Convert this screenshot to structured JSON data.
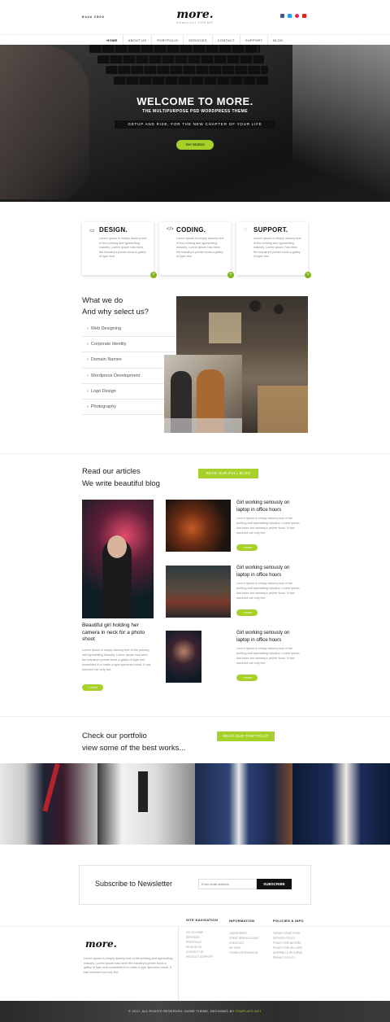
{
  "header": {
    "est": "Estd 1900",
    "logo": "more.",
    "tagline": "Beautiful THEME",
    "social": [
      {
        "icon": "facebook-icon",
        "color": "#3b5998"
      },
      {
        "icon": "twitter-icon",
        "color": "#1da1f2"
      },
      {
        "icon": "pinterest-icon",
        "color": "#e0245e"
      },
      {
        "icon": "youtube-icon",
        "color": "#e62117"
      }
    ]
  },
  "nav": [
    "HOME",
    "ABOUT US",
    "PORTFOLIO",
    "SERVICES",
    "CONTACT",
    "SUPPORT",
    "BLOG"
  ],
  "hero": {
    "title": "WELCOME TO MORE.",
    "subtitle": "THE MULTIPURPOSE PSD WORDPRESS THEME",
    "bar": "GETUP AND RISE, FOR THE NEW CHAPTER OF YOUR LIFE",
    "button": "Get Started"
  },
  "services": [
    {
      "icon": "monitor-icon",
      "glyph": "▭",
      "title": "DESIGN.",
      "text": "Lorem Ipsum is simply dummy text of the printing and typesetting industry. Lorem Ipsum has been the industry's printer book a galley of type and"
    },
    {
      "icon": "code-icon",
      "glyph": "</>",
      "title": "CODING.",
      "text": "Lorem Ipsum is simply dummy text of the printing and typesetting industry. Lorem Ipsum has been the industry's printer book a galley of type and"
    },
    {
      "icon": "chat-icon",
      "glyph": "◌",
      "title": "SUPPORT.",
      "text": "Lorem Ipsum is simply dummy text of the printing and typesetting industry. Lorem Ipsum has been the industry's printer book a galley of type and"
    }
  ],
  "what": {
    "title_line1": "What we do",
    "title_line2": "And why select us?",
    "items": [
      "Web Designing",
      "Corporate Identity",
      "Domain Names",
      "Wordpress Development",
      "Logo Design",
      "Photography"
    ]
  },
  "blog": {
    "title_line1": "Read our articles",
    "title_line2": "We write beautiful blog",
    "button": "READ OUR FULL BLOG",
    "featured": {
      "title": "Beautiful girl holding her camera in neck for a photo shoot",
      "text": "Lorem Ipsum is simply dummy text of the printing and typesetting industry. Lorem Ipsum has been the industry's printer book a galley of type and scrambled it to make a type specimen book. It has survived not only five",
      "more": "+ more"
    },
    "posts": [
      {
        "title": "Girl working seriously on laptop in office hours",
        "text": "Lorem Ipsum is simply dummy text of the printing and typesetting industry. Lorem Ipsum has been the industry's printer book. It has survived not only five",
        "more": "+ more"
      },
      {
        "title": "Girl working seriously on laptop in office hours",
        "text": "Lorem Ipsum is simply dummy text of the printing and typesetting industry. Lorem Ipsum has been the industry's printer book. It has survived not only five",
        "more": "+ more"
      },
      {
        "title": "Girl working seriously on laptop in office hours",
        "text": "Lorem Ipsum is simply dummy text of the printing and typesetting industry. Lorem Ipsum has been the industry's printer book. It has survived not only five",
        "more": "+ more"
      }
    ]
  },
  "portfolio": {
    "title_line1": "Check our portfolio",
    "title_line2": "view some of the best works...",
    "button": "READ OUR PORTFOLIO"
  },
  "newsletter": {
    "title": "Subscribe to Newsletter",
    "placeholder": "Enter email address",
    "button": "SUBSCRIBE"
  },
  "footer": {
    "logo": "more.",
    "text": "Lorem Ipsum is simply dummy text of the printing and typesetting industry. Lorem Ipsum has been the industry's printer book a galley of type and scrambled it to make a type specimen book. It has survived not only five",
    "columns": [
      {
        "heading": "SITE NAVIGATION",
        "links": [
          "GO TO HOME",
          "SERVICES",
          "PORTFOLIO",
          "READ BLOG",
          "CONTACT US",
          "PRODUCT SUPPORT"
        ]
      },
      {
        "heading": "INFORMATION",
        "links": [
          "LEARN MORE",
          "CREAT NEW ACCOUNT",
          "CHECKOUT",
          "MY CART",
          "OTHER INFORMATION"
        ]
      },
      {
        "heading": "POLICIES & INFO",
        "links": [
          "TERMS CONDITIONS",
          "SERVICE POLICY",
          "POLICY FOR BUYERS",
          "POLICY FOR SELLERS",
          "SHIPPING & RETURNS",
          "PRIVACY POLICY"
        ]
      }
    ],
    "copyright": "© 2017, ALL RIGHTS RESERVED. MORE THEME, DESIGNED BY",
    "copyright_link": "TEMPLATE.NET",
    "accent": "#a6d12b"
  }
}
